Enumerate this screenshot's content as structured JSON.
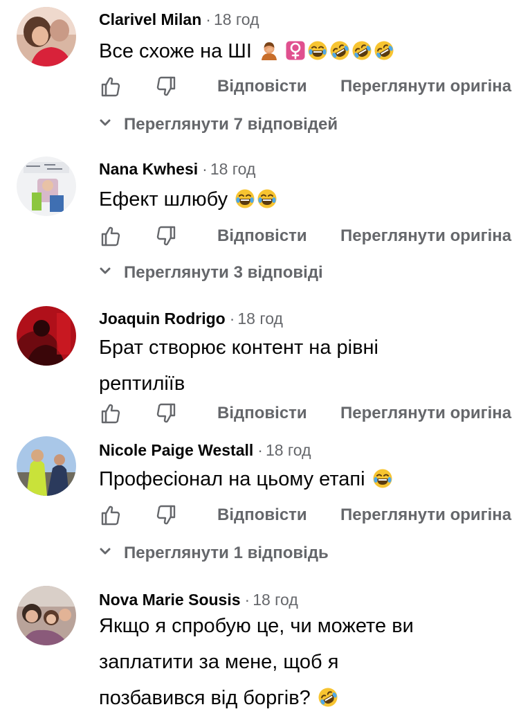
{
  "actions": {
    "reply_label": "Відповісти",
    "translate_label": "Переглянути оригіна"
  },
  "comments": [
    {
      "author": "Clarivel Milan",
      "time": "18 год",
      "text_lines": [
        "Все схоже на ШІ"
      ],
      "emojis": [
        "person-facepalming",
        "female-sign",
        "laughing",
        "rolling-laughing",
        "rolling-laughing",
        "rolling-laughing"
      ],
      "replies": "Переглянути 7 відповідей"
    },
    {
      "author": "Nana Kwhesi",
      "time": "18 год",
      "text_lines": [
        "Ефект шлюбу"
      ],
      "emojis": [
        "laughing",
        "laughing"
      ],
      "replies": "Переглянути 3 відповіді"
    },
    {
      "author": "Joaquin Rodrigo",
      "time": "18 год",
      "text_lines": [
        "Брат створює контент на рівні",
        "рептиліїв"
      ],
      "emojis": [],
      "replies": ""
    },
    {
      "author": "Nicole Paige Westall",
      "time": "18 год",
      "text_lines": [
        "Професіонал на цьому етапі"
      ],
      "emojis": [
        "laughing"
      ],
      "replies": "Переглянути 1 відповідь"
    },
    {
      "author": "Nova Marie Sousis",
      "time": "18 год",
      "text_lines": [
        "Якщо я спробую це, чи можете ви",
        "заплатити за мене, щоб я",
        "позбавився від боргів?"
      ],
      "emojis": [
        "rolling-laughing"
      ],
      "replies": ""
    }
  ],
  "colors": {
    "text": "#050505",
    "secondary": "#65676b",
    "background": "#ffffff",
    "emoji_face": "#f7c431"
  }
}
